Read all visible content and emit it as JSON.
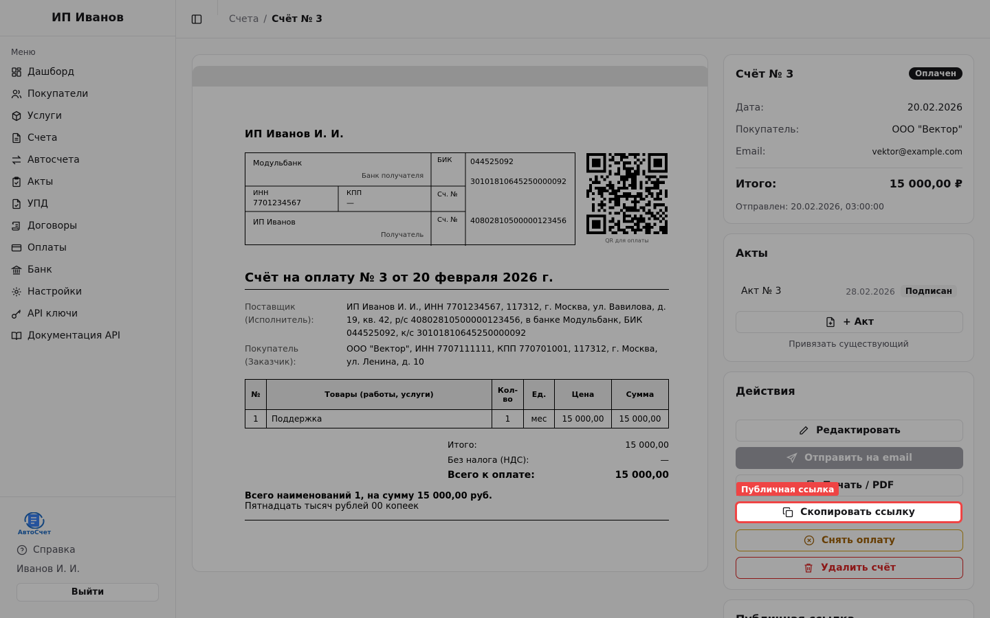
{
  "sidebar": {
    "brand": "ИП Иванов",
    "menu_title": "Меню",
    "items": [
      {
        "label": "Дашборд"
      },
      {
        "label": "Покупатели"
      },
      {
        "label": "Услуги"
      },
      {
        "label": "Счета"
      },
      {
        "label": "Автосчета"
      },
      {
        "label": "Акты"
      },
      {
        "label": "УПД"
      },
      {
        "label": "Договоры"
      },
      {
        "label": "Оплаты"
      },
      {
        "label": "Банк"
      },
      {
        "label": "Настройки"
      },
      {
        "label": "API ключи"
      },
      {
        "label": "Документация API"
      }
    ],
    "logo_text": "АвтоСчет",
    "help": "Справка",
    "user": "Иванов И. И.",
    "logout": "Выйти"
  },
  "breadcrumb": {
    "parent": "Счета",
    "separator": "/",
    "current": "Счёт № 3"
  },
  "invoice": {
    "seller": "ИП Иванов И. И.",
    "bank": {
      "bank_name": "Модульбанк",
      "bank_label": "Банк получателя",
      "inn_label": "ИНН",
      "inn": "7701234567",
      "kpp_label": "КПП",
      "kpp": "—",
      "recipient": "ИП Иванов",
      "recipient_label": "Получатель",
      "bik_label": "БИК",
      "bik": "044525092",
      "corr_account": "30101810645250000092",
      "acc_label_1": "Сч. №",
      "acc_label_2": "Сч. №",
      "account": "40802810500000123456"
    },
    "qr_caption": "QR для оплаты",
    "title": "Счёт на оплату № 3 от 20 февраля 2026 г.",
    "supplier_label": "Поставщик (Исполнитель):",
    "supplier": "ИП Иванов И. И., ИНН 7701234567, 117312, г. Москва, ул. Вавилова, д. 19, кв. 42, р/с 40802810500000123456, в банке Модульбанк, БИК 044525092, к/с 30101810645250000092",
    "buyer_label": "Покупатель (Заказчик):",
    "buyer": "ООО \"Вектор\", ИНН 7707111111, КПП 770701001, 117312, г. Москва, ул. Ленина, д. 10",
    "table": {
      "headers": [
        "№",
        "Товары (работы, услуги)",
        "Кол-во",
        "Ед.",
        "Цена",
        "Сумма"
      ],
      "rows": [
        [
          "1",
          "Поддержка",
          "1",
          "мес",
          "15 000,00",
          "15 000,00"
        ]
      ]
    },
    "total_label": "Итого:",
    "total": "15 000,00",
    "vat_label": "Без налога (НДС):",
    "vat": "—",
    "grand_label": "Всего к оплате:",
    "grand": "15 000,00",
    "summary_line1": "Всего наименований 1, на сумму 15 000,00 руб.",
    "summary_line2": "Пятнадцать тысяч рублей 00 копеек"
  },
  "info_panel": {
    "title": "Счёт № 3",
    "status": "Оплачен",
    "date_label": "Дата:",
    "date": "20.02.2026",
    "buyer_label": "Покупатель:",
    "buyer": "ООО \"Вектор\"",
    "email_label": "Email:",
    "email": "vektor@example.com",
    "total_label": "Итого:",
    "total": "15 000,00 ₽",
    "sent": "Отправлен: 20.02.2026, 03:00:00"
  },
  "acts_panel": {
    "title": "Акты",
    "act_name": "Акт № 3",
    "act_date": "28.02.2026",
    "act_status": "Подписан",
    "add_act": "+ Акт",
    "link_existing": "Привязать существующий"
  },
  "actions_panel": {
    "title": "Действия",
    "edit": "Редактировать",
    "send_email": "Отправить на email",
    "print": "Печать / PDF",
    "copy_link": "Скопировать ссылку",
    "remove_payment": "Снять оплату",
    "delete": "Удалить счёт"
  },
  "public_link_panel": {
    "title": "Публичная ссылка"
  },
  "highlight": {
    "label": "Публичная ссылка",
    "color": "#ef4444"
  },
  "colors": {
    "overlay": "rgba(0,0,0,0.36)",
    "warning": "#d4a017",
    "danger": "#dc2626"
  }
}
